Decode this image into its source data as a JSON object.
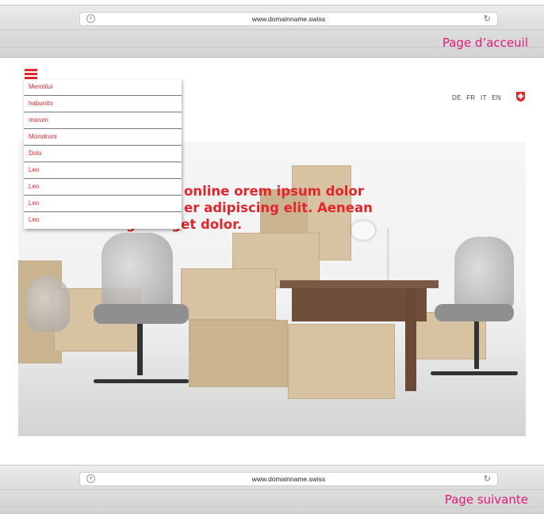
{
  "browser_top": {
    "url": "www.domainname.swiss",
    "page_label": "Page d’acceuil"
  },
  "browser_bottom": {
    "url": "www.domainname.swiss",
    "page_label": "Page suivante"
  },
  "menu": {
    "items": [
      "Merotilui",
      "habunito",
      "marum",
      "Monstrum",
      "Dolo",
      "Leo",
      "Leo",
      "Leo",
      "Leo"
    ]
  },
  "languages": [
    "DE",
    "FR",
    "IT",
    "EN"
  ],
  "hero": {
    "text_line1": "online orem ipsum dolor",
    "text_line2": "er adipiscing elit. Aenean",
    "text_line3": "commodo ligula eget dolor."
  },
  "colors": {
    "accent_red": "#e1262d",
    "label_magenta": "#e0187a"
  },
  "icons": {
    "menu": "hamburger-icon",
    "flag": "swiss-cross-icon",
    "tab_add": "plus-icon",
    "reload": "reload-icon"
  }
}
